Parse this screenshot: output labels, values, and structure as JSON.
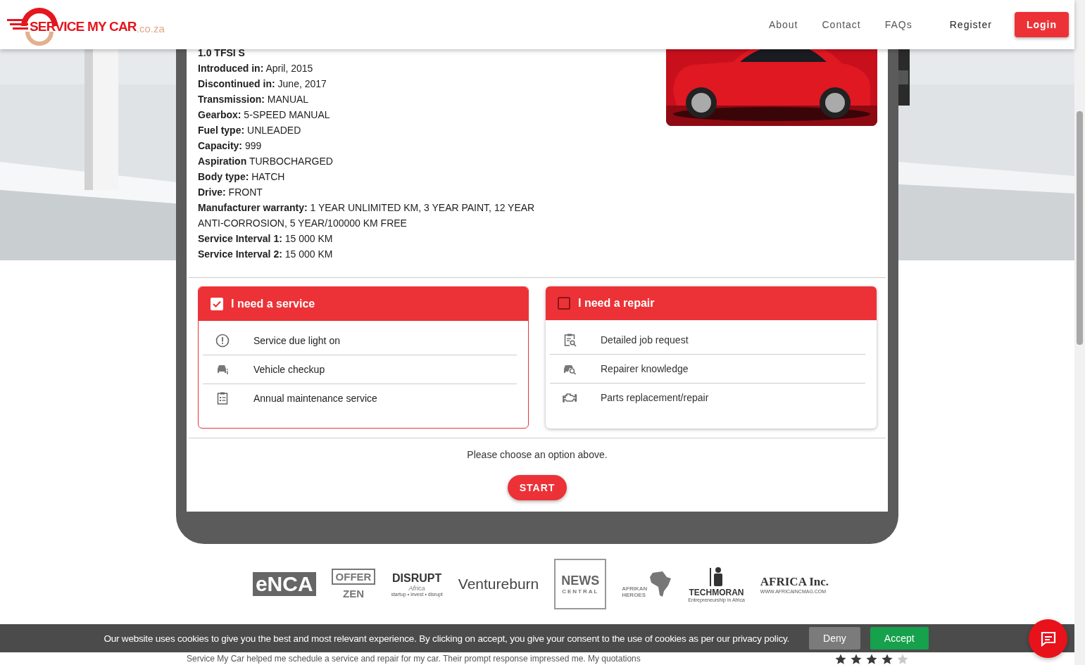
{
  "header": {
    "logo": {
      "name": "SERVICE MY CAR",
      "suffix": ".co.za"
    },
    "nav": [
      {
        "label": "About",
        "kind": "link"
      },
      {
        "label": "Contact",
        "kind": "link"
      },
      {
        "label": "FAQs",
        "kind": "link"
      },
      {
        "label": "Register",
        "kind": "strong"
      },
      {
        "label": "Login",
        "kind": "button"
      }
    ]
  },
  "vehicle": {
    "title": "1.0 TFSI S",
    "specs": [
      {
        "label": "Introduced in:",
        "value": "April, 2015"
      },
      {
        "label": "Discontinued in:",
        "value": "June, 2017"
      },
      {
        "label": "Transmission:",
        "value": "MANUAL"
      },
      {
        "label": "Gearbox:",
        "value": "5-SPEED MANUAL"
      },
      {
        "label": "Fuel type:",
        "value": "UNLEADED"
      },
      {
        "label": "Capacity:",
        "value": "999"
      },
      {
        "label": "Aspiration",
        "value": "TURBOCHARGED"
      },
      {
        "label": "Body type:",
        "value": "HATCH"
      },
      {
        "label": "Drive:",
        "value": "FRONT"
      },
      {
        "label": "Manufacturer warranty:",
        "value": "1 YEAR UNLIMITED KM, 3 YEAR PAINT, 12 YEAR ANTI-CORROSION, 5 YEAR/100000 KM FREE"
      },
      {
        "label": "Service Interval 1:",
        "value": "15 000 KM"
      },
      {
        "label": "Service Interval 2:",
        "value": "15 000 KM"
      }
    ]
  },
  "options": [
    {
      "title": "I need a service",
      "selected": true,
      "items": [
        {
          "kind": "alert",
          "label": "Service due light on"
        },
        {
          "kind": "car-info",
          "label": "Vehicle checkup"
        },
        {
          "kind": "checklist",
          "label": "Annual maintenance service"
        }
      ]
    },
    {
      "title": "I need a repair",
      "selected": false,
      "items": [
        {
          "kind": "request",
          "label": "Detailed job request"
        },
        {
          "kind": "knowledge",
          "label": "Repairer knowledge"
        },
        {
          "kind": "parts",
          "label": "Parts replacement/repair"
        }
      ]
    }
  ],
  "prompt": "Please choose an option above.",
  "start_button": "START",
  "press_logos": [
    {
      "kind": "filled",
      "texts": [
        "eNCA"
      ]
    },
    {
      "kind": "split",
      "texts": [
        "OFFER",
        "ZEN"
      ]
    },
    {
      "kind": "ring",
      "texts": [
        "DISRUPT",
        "Africa",
        "startup • invest • disrupt"
      ]
    },
    {
      "kind": "plain",
      "texts": [
        "Ventureburn"
      ]
    },
    {
      "kind": "framed",
      "texts": [
        "NEWS",
        "CENTRAL"
      ]
    },
    {
      "kind": "map",
      "texts": [
        "AFRIKAN",
        "HEROES"
      ]
    },
    {
      "kind": "figure",
      "texts": [
        "TECHMORAN",
        "Entrepreneurship in Africa"
      ]
    },
    {
      "kind": "serif",
      "texts": [
        "AFRICA Inc.",
        "WWW.AFRICAINCMAG.COM"
      ]
    }
  ],
  "cookie_banner": {
    "text": "Our website uses cookies to give you the best and most relevant experience. By clicking on accept, you give your consent to the use of cookies as per our privacy policy.",
    "buttons": [
      {
        "label": "Deny",
        "kind": "deny"
      },
      {
        "label": "Accept",
        "kind": "accept"
      }
    ]
  },
  "testimonial": {
    "text": "Service My Car helped me schedule a service and repair for my car. Their prompt response impressed me. My quotations",
    "stars": 4
  }
}
